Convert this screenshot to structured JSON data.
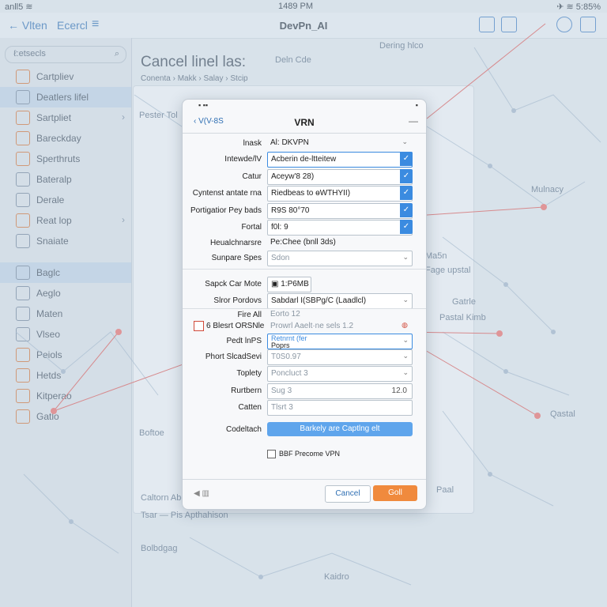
{
  "status_bar": {
    "left": "anll5 ≋",
    "time": "1489 PM",
    "right": "✈ ≋ 5:85%"
  },
  "nav": {
    "back_label": "← Vlten",
    "edit_label": "Ecercl",
    "menu_icon": "≡",
    "title": "DevPn_AI"
  },
  "sidebar": {
    "search_label": "ℓ:etsecls",
    "items": [
      {
        "label": "Cartpliev",
        "icon": "folder-icon"
      },
      {
        "label": "Deatlers lifel",
        "icon": "list-icon"
      },
      {
        "label": "Sartpliet",
        "icon": "doc-icon"
      },
      {
        "label": "Bareckday",
        "icon": "lock-icon"
      },
      {
        "label": "Sperthruts",
        "icon": "gear-icon"
      },
      {
        "label": "Bateralp",
        "icon": "shield-icon"
      },
      {
        "label": "Derale",
        "icon": "doc-icon"
      },
      {
        "label": "Reat lop",
        "icon": "grid-icon"
      },
      {
        "label": "Snaiate",
        "icon": "user-icon"
      },
      {
        "label": "Baglc",
        "icon": "globe-icon"
      },
      {
        "label": "Aeglo",
        "icon": "list-icon"
      },
      {
        "label": "Maten",
        "icon": "image-icon"
      },
      {
        "label": "Vlseo",
        "icon": "doc-icon"
      },
      {
        "label": "Peiols",
        "icon": "folder-icon"
      },
      {
        "label": "Hetds",
        "icon": "grid-icon"
      },
      {
        "label": "Kitperao",
        "icon": "doc-icon"
      },
      {
        "label": "Gatlo",
        "icon": "gear-icon"
      }
    ]
  },
  "main": {
    "title": "Cancel linel las:",
    "crumbs": "Conenta  ›  Makk  ›  Salay  ›  Stcip",
    "bg_texts": [
      "Dering hlco",
      "Deln Cde",
      "Pester Tol",
      "Mulnacy",
      "Ma5n",
      "Fage upstal",
      "Gatrle",
      "Pastal Kimb",
      "Qastal",
      "Caltorn Abelmes",
      "Paal",
      "Bolbdgag",
      "Tsar — Pis Apthahison",
      "Boftoe",
      "Kaidro"
    ]
  },
  "dialog": {
    "top_left": "▪ ▪▪",
    "top_right": "▪",
    "back_label": "‹ V(V-8S",
    "title": "VRN",
    "fields": [
      {
        "label": "lnask",
        "value": "Al: DKVPN",
        "style": "plain"
      },
      {
        "label": "Intewde/lV",
        "value": "Acberin de-ltteitew",
        "style": "check"
      },
      {
        "label": "Catur",
        "value": "Aceyw'8 28)",
        "style": "check"
      },
      {
        "label": "Cyntenst antate rna",
        "value": "Riedbeas to ɵWTHYII)",
        "style": "check"
      },
      {
        "label": "Portigatior Pey bads",
        "value": "R9S 80°70",
        "style": "check"
      },
      {
        "label": "Fortal",
        "value": "f0l: 9",
        "style": "check"
      },
      {
        "label": "Heualchnarsre",
        "value": "Pe:Chee (bnll 3ds)",
        "style": "plain"
      },
      {
        "label": "Sunpare Spes",
        "value": "Sdon",
        "style": "dropdown"
      },
      {
        "label": "Sapck Car Mote",
        "value": "▣ 1:P6MB",
        "style": "small"
      },
      {
        "label": "Slror Pordovs",
        "value": "Sabdarl I(SBPɡ/C (Laadlcl)",
        "style": "dropdown"
      },
      {
        "label": "Fire All",
        "value": "Eorto  12",
        "style": "plain"
      },
      {
        "label": "Pedt lnPS",
        "value": "Poprs",
        "style": "dropdown"
      },
      {
        "label": "Phort SlcadSevi",
        "value": "T0S0.97",
        "style": "dropdown"
      },
      {
        "label": "Toplety",
        "value": "Poncluct 3",
        "style": "dropdown"
      },
      {
        "label": "Rurtbern",
        "value": "Sug 3",
        "num": "12.0",
        "style": "num"
      },
      {
        "label": "Catten",
        "value": "Tlsrt 3",
        "style": "plain-box"
      }
    ],
    "fire_row_label": "6 Blesrt ORSNle",
    "fire_row_value": "Prowrl Aaelt·ne sels 1.2",
    "fire_row_sub": "Retnrnt (fer",
    "action_label": "Codeltach",
    "action_button": "Barkely are Captlng elt",
    "checkbox_label": "BBF Precome VPN",
    "cancel_button": "Cancel",
    "go_button": "Goll",
    "foot_icon": "◀ ▥"
  },
  "colors": {
    "accent": "#3b8be0",
    "go": "#f08a3d",
    "edge": "#d45a5a"
  }
}
